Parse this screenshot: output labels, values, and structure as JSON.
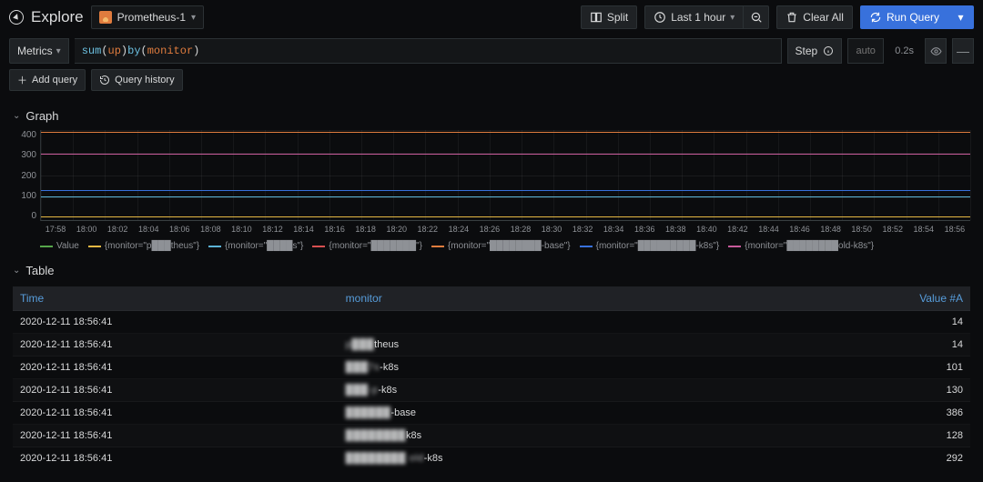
{
  "header": {
    "title": "Explore",
    "datasource": "Prometheus-1",
    "split": "Split",
    "timerange": "Last 1 hour",
    "clear_all": "Clear All",
    "run_query": "Run Query"
  },
  "query": {
    "metrics_label": "Metrics",
    "expr_fn": "sum",
    "expr_arg": "up",
    "expr_by": "by",
    "expr_group": "monitor",
    "step_label": "Step",
    "step_value": "auto",
    "timing": "0.2s",
    "add_query": "Add query",
    "query_history": "Query history"
  },
  "graph": {
    "title": "Graph",
    "y_ticks": [
      "400",
      "300",
      "200",
      "100",
      "0"
    ],
    "x_ticks": [
      "17:58",
      "18:00",
      "18:02",
      "18:04",
      "18:06",
      "18:08",
      "18:10",
      "18:12",
      "18:14",
      "18:16",
      "18:18",
      "18:20",
      "18:22",
      "18:24",
      "18:26",
      "18:28",
      "18:30",
      "18:32",
      "18:34",
      "18:36",
      "18:38",
      "18:40",
      "18:42",
      "18:44",
      "18:46",
      "18:48",
      "18:50",
      "18:52",
      "18:54",
      "18:56"
    ],
    "legend": [
      {
        "color": "#56a64b",
        "label": "Value"
      },
      {
        "color": "#e5b843",
        "label": "{monitor=\"p███theus\"}"
      },
      {
        "color": "#5bb3d6",
        "label": "{monitor=\"████s\"}"
      },
      {
        "color": "#d85050",
        "label": "{monitor=\"███████\"}"
      },
      {
        "color": "#e07c3e",
        "label": "{monitor=\"████████-base\"}"
      },
      {
        "color": "#3871dc",
        "label": "{monitor=\"█████████-k8s\"}"
      },
      {
        "color": "#c75a9a",
        "label": "{monitor=\"████████old-k8s\"}"
      }
    ]
  },
  "chart_data": {
    "type": "line",
    "xlabel": "",
    "ylabel": "",
    "ylim": [
      0,
      400
    ],
    "x_range": [
      "17:58",
      "18:56"
    ],
    "series": [
      {
        "name": "Value",
        "approx_value": 14,
        "color": "#56a64b"
      },
      {
        "name": "{monitor=\"p███theus\"}",
        "approx_value": 14,
        "color": "#e5b843"
      },
      {
        "name": "{monitor=\"████s\"}",
        "approx_value": 101,
        "color": "#5bb3d6"
      },
      {
        "name": "{monitor=\"███████\"}",
        "approx_value": 130,
        "color": "#d85050"
      },
      {
        "name": "{monitor=\"████████-base\"}",
        "approx_value": 386,
        "color": "#e07c3e"
      },
      {
        "name": "{monitor=\"█████████-k8s\"}",
        "approx_value": 128,
        "color": "#3871dc"
      },
      {
        "name": "{monitor=\"████████old-k8s\"}",
        "approx_value": 292,
        "color": "#c75a9a"
      }
    ],
    "note": "Each series is approximately flat across the visible time window; approx_value is the constant y-level read from the chart."
  },
  "table": {
    "title": "Table",
    "columns": [
      "Time",
      "monitor",
      "Value #A"
    ],
    "rows": [
      {
        "time": "2020-12-11 18:56:41",
        "monitor_blur": "",
        "monitor_suffix": "",
        "value": "14"
      },
      {
        "time": "2020-12-11 18:56:41",
        "monitor_blur": "p███",
        "monitor_suffix": "theus",
        "value": "14"
      },
      {
        "time": "2020-12-11 18:56:41",
        "monitor_blur": "███7s",
        "monitor_suffix": "-k8s",
        "value": "101"
      },
      {
        "time": "2020-12-11 18:56:41",
        "monitor_blur": "███-p",
        "monitor_suffix": "-k8s",
        "value": "130"
      },
      {
        "time": "2020-12-11 18:56:41",
        "monitor_blur": "██████",
        "monitor_suffix": "-base",
        "value": "386"
      },
      {
        "time": "2020-12-11 18:56:41",
        "monitor_blur": "████████",
        "monitor_suffix": "k8s",
        "value": "128"
      },
      {
        "time": "2020-12-11 18:56:41",
        "monitor_blur": "████████ old",
        "monitor_suffix": "-k8s",
        "value": "292"
      }
    ]
  }
}
